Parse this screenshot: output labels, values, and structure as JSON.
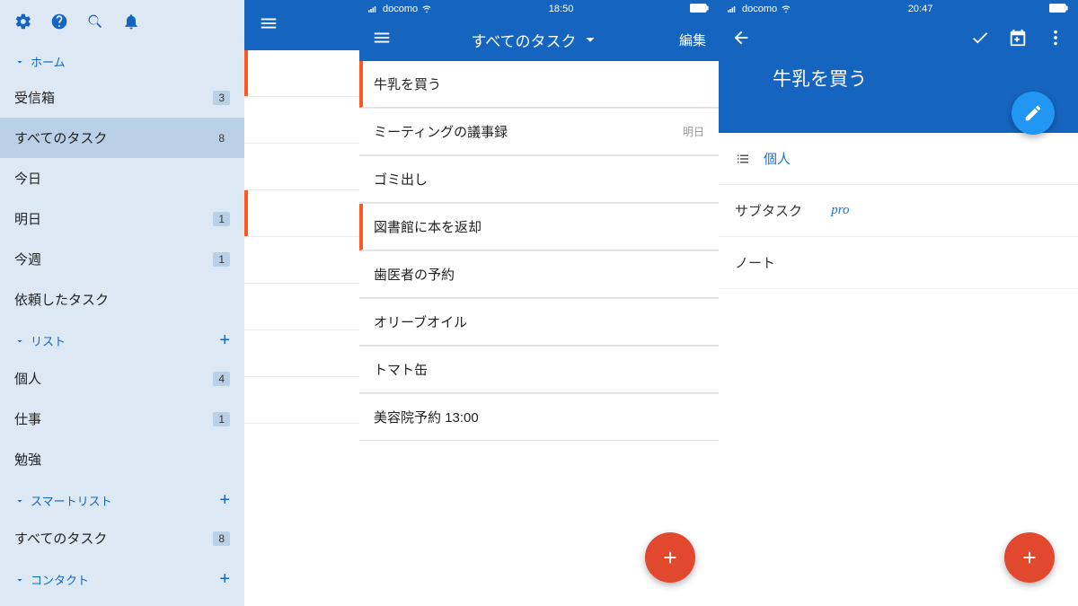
{
  "sidebar": {
    "sections": {
      "home": {
        "label": "ホーム"
      },
      "lists": {
        "label": "リスト"
      },
      "smart": {
        "label": "スマートリスト"
      },
      "contacts": {
        "label": "コンタクト"
      }
    },
    "home_items": [
      {
        "label": "受信箱",
        "badge": "3"
      },
      {
        "label": "すべてのタスク",
        "badge": "8"
      },
      {
        "label": "今日",
        "badge": ""
      },
      {
        "label": "明日",
        "badge": "1"
      },
      {
        "label": "今週",
        "badge": "1"
      },
      {
        "label": "依頼したタスク",
        "badge": ""
      }
    ],
    "list_items": [
      {
        "label": "個人",
        "badge": "4"
      },
      {
        "label": "仕事",
        "badge": "1"
      },
      {
        "label": "勉強",
        "badge": ""
      }
    ],
    "smart_items": [
      {
        "label": "すべてのタスク",
        "badge": "8"
      }
    ]
  },
  "panel2": {
    "status": {
      "carrier": "docomo",
      "time": "18:50"
    },
    "title": "すべてのタスク",
    "edit": "編集",
    "tasks": [
      {
        "title": "牛乳を買う",
        "due": "",
        "marked": true
      },
      {
        "title": "ミーティングの議事録",
        "due": "明日",
        "marked": false
      },
      {
        "title": "ゴミ出し",
        "due": "",
        "marked": false
      },
      {
        "title": "図書館に本を返却",
        "due": "",
        "marked": true
      },
      {
        "title": "歯医者の予約",
        "due": "",
        "marked": false
      },
      {
        "title": "オリーブオイル",
        "due": "",
        "marked": false
      },
      {
        "title": "トマト缶",
        "due": "",
        "marked": false
      },
      {
        "title": "美容院予約 13:00",
        "due": "",
        "marked": false
      }
    ]
  },
  "panel3": {
    "status": {
      "carrier": "docomo",
      "time": "20:47"
    },
    "title": "牛乳を買う",
    "list_label": "個人",
    "subtask_label": "サブタスク",
    "pro": "pro",
    "notes_label": "ノート"
  }
}
